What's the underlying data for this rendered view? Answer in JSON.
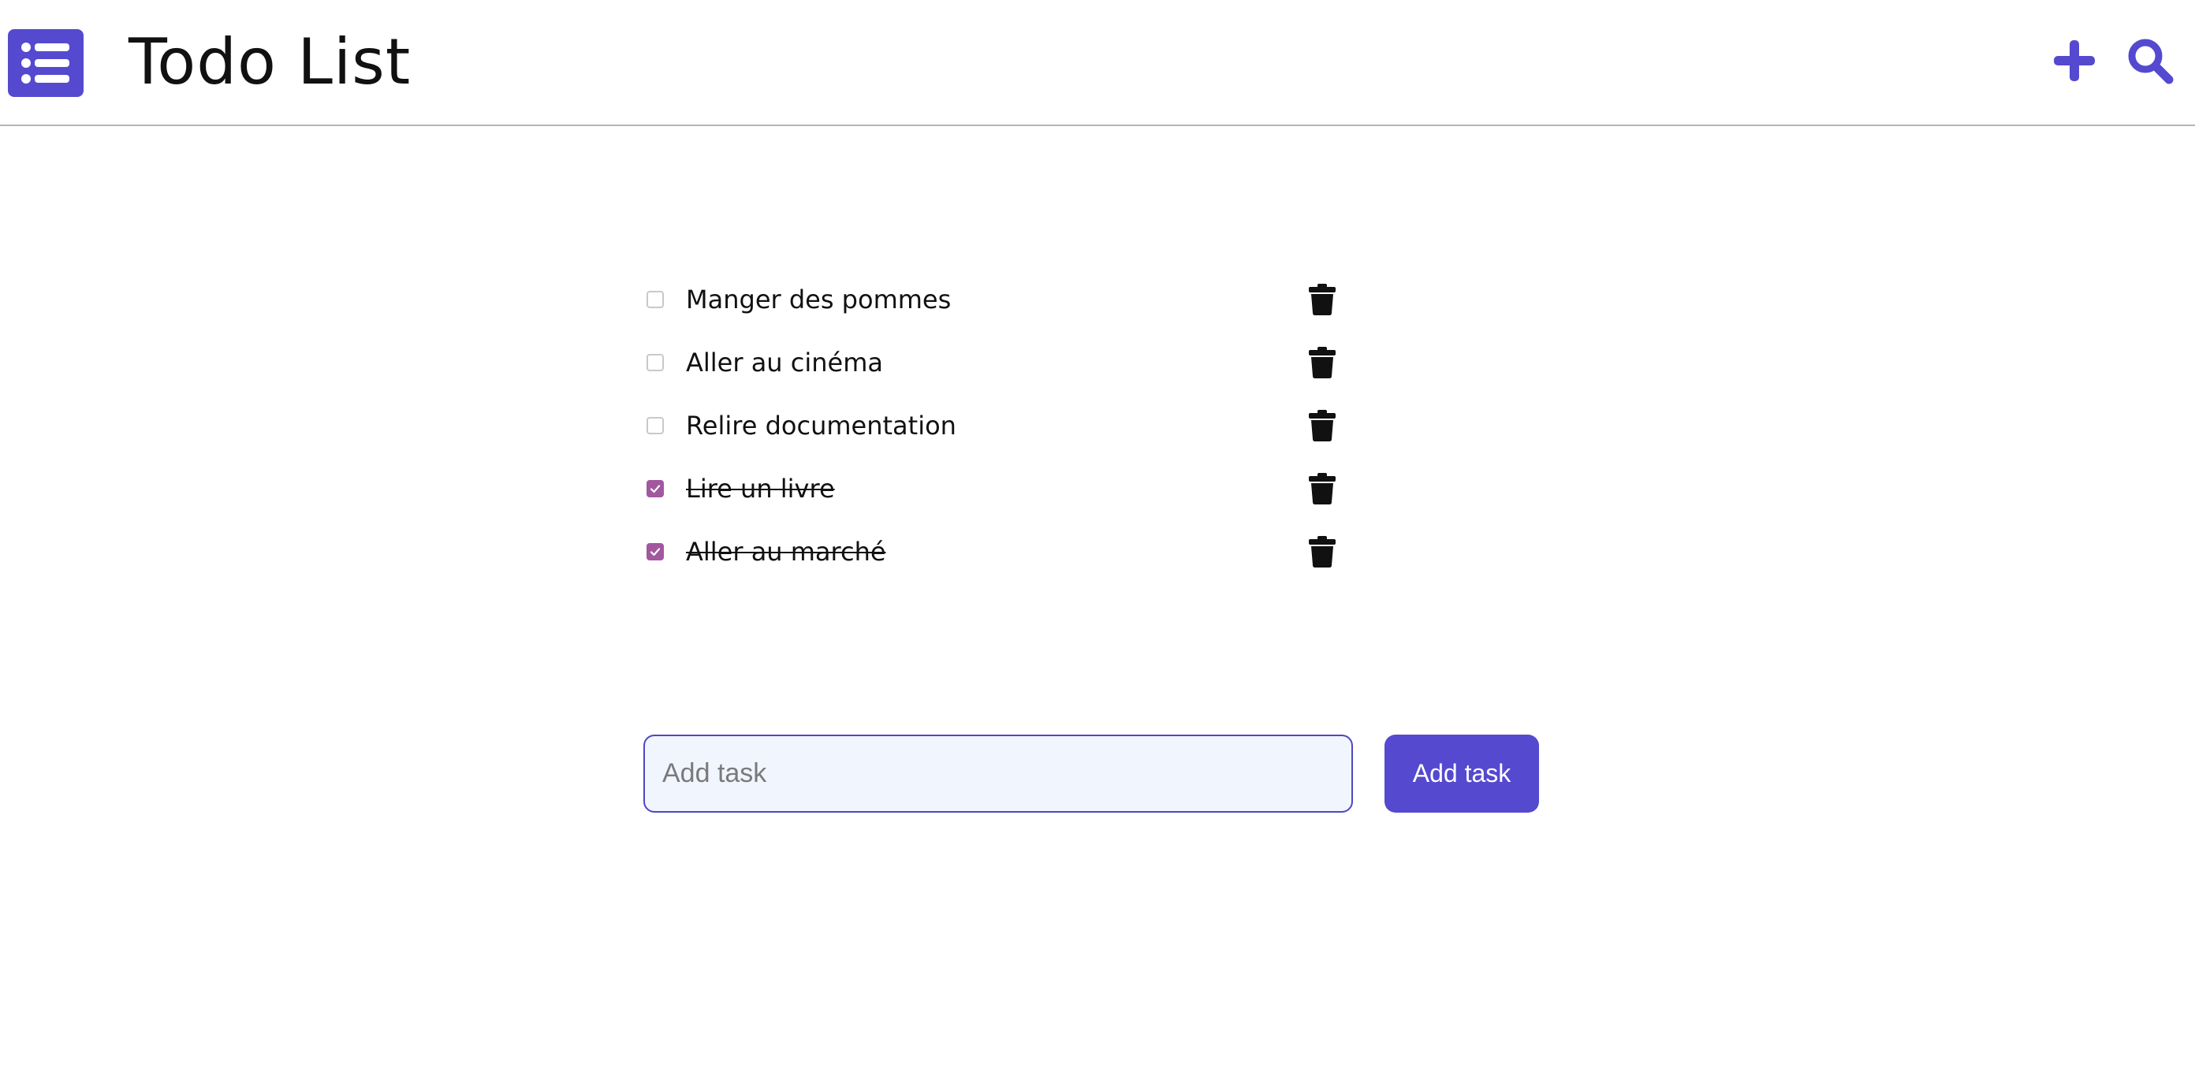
{
  "header": {
    "logo_icon": "list-icon",
    "title": "Todo List",
    "add_icon": "plus-icon",
    "search_icon": "search-icon",
    "accent_color": "#5549cf"
  },
  "tasks": [
    {
      "label": "Manger des pommes",
      "done": false,
      "delete_icon": "trash-icon"
    },
    {
      "label": "Aller au cinéma",
      "done": false,
      "delete_icon": "trash-icon"
    },
    {
      "label": "Relire documentation",
      "done": false,
      "delete_icon": "trash-icon"
    },
    {
      "label": "Lire un livre",
      "done": true,
      "delete_icon": "trash-icon"
    },
    {
      "label": "Aller au marché",
      "done": true,
      "delete_icon": "trash-icon"
    }
  ],
  "add_form": {
    "placeholder": "Add task",
    "value": "",
    "button_label": "Add task"
  },
  "colors": {
    "checkbox_checked": "#a2579f",
    "input_border": "#4f46c5",
    "input_background": "#f1f5fd"
  }
}
